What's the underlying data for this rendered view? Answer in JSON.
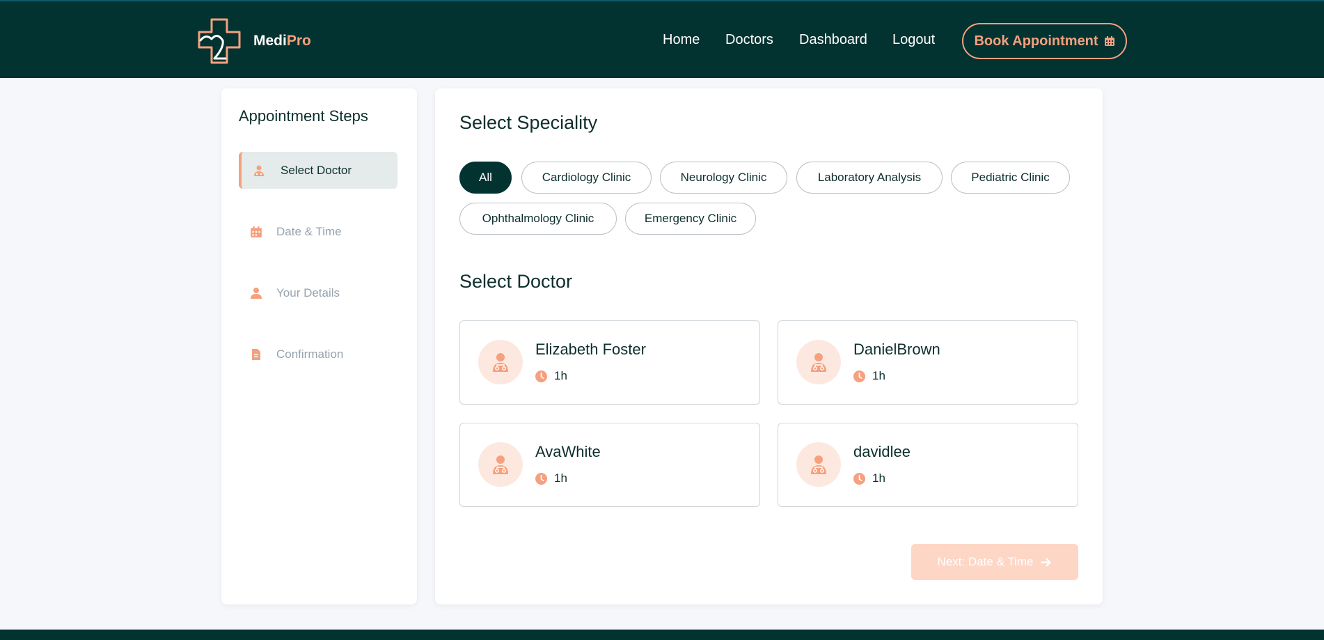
{
  "header": {
    "brand_part1": "Medi",
    "brand_part2": "Pro",
    "nav": [
      "Home",
      "Doctors",
      "Dashboard",
      "Logout"
    ],
    "book_label": "Book Appointment",
    "book_icon": "calendar-icon"
  },
  "sidebar": {
    "title": "Appointment Steps",
    "steps": [
      {
        "label": "Select Doctor",
        "icon": "doctor-icon",
        "active": true
      },
      {
        "label": "Date & Time",
        "icon": "calendar-icon",
        "active": false
      },
      {
        "label": "Your Details",
        "icon": "user-icon",
        "active": false
      },
      {
        "label": "Confirmation",
        "icon": "document-icon",
        "active": false
      }
    ]
  },
  "main": {
    "speciality_title": "Select Speciality",
    "specialities": [
      "All",
      "Cardiology Clinic",
      "Neurology Clinic",
      "Laboratory Analysis",
      "Pediatric Clinic",
      "Ophthalmology Clinic",
      "Emergency Clinic"
    ],
    "selected_speciality": "All",
    "doctor_title": "Select Doctor",
    "doctors": [
      {
        "name": "Elizabeth Foster",
        "duration": "1h"
      },
      {
        "name": "DanielBrown",
        "duration": "1h"
      },
      {
        "name": "AvaWhite",
        "duration": "1h"
      },
      {
        "name": "davidlee",
        "duration": "1h"
      }
    ],
    "next_label": "Next: Date & Time"
  },
  "colors": {
    "primary": "#033330",
    "accent": "#f5a07f",
    "accent_light": "#fde8df",
    "disabled_button": "#fdd6c6"
  }
}
